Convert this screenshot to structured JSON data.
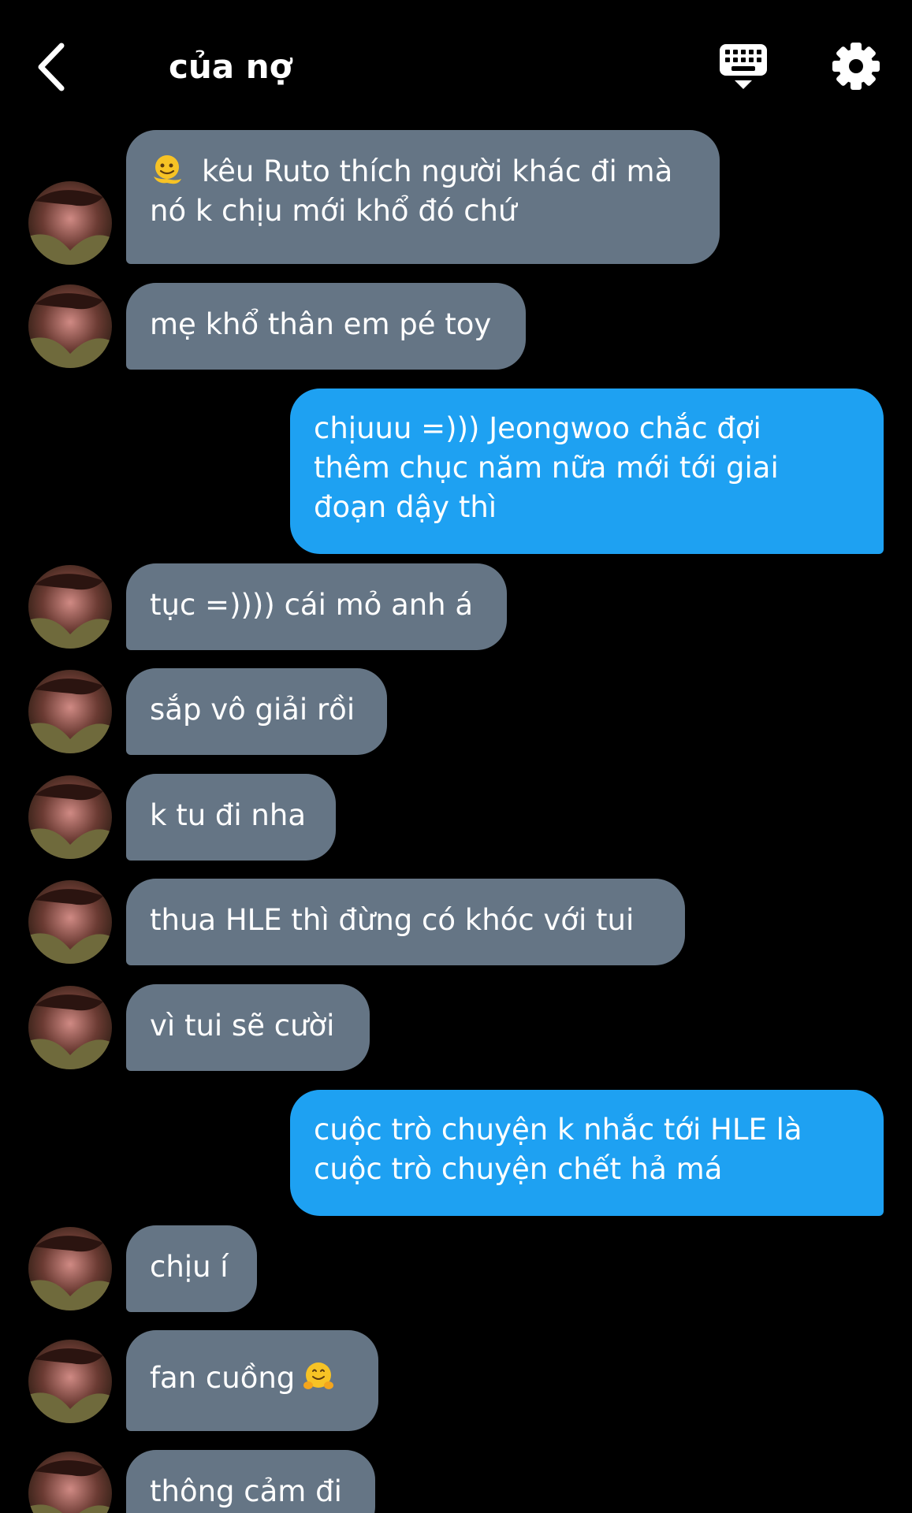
{
  "header": {
    "title": "của nợ",
    "back_icon": "chevron-left-icon",
    "keyboard_icon": "keyboard-icon",
    "settings_icon": "gear-icon"
  },
  "colors": {
    "background": "#000000",
    "incoming_bubble": "#657585",
    "outgoing_bubble": "#1ea1f2",
    "text": "#ffffff"
  },
  "messages": [
    {
      "side": "incoming",
      "emoji": "melting-face-emoji",
      "text": "kêu Ruto thích người khác đi mà\nnó k chịu mới khổ đó chứ"
    },
    {
      "side": "incoming",
      "text": "mẹ khổ thân em pé toy"
    },
    {
      "side": "outgoing",
      "text": "chịuuu =))) Jeongwoo chắc đợi\nthêm chục năm nữa mới tới giai\nđoạn dậy thì"
    },
    {
      "side": "incoming",
      "text": "tục =)))) cái mỏ anh á"
    },
    {
      "side": "incoming",
      "text": "sắp vô giải rồi"
    },
    {
      "side": "incoming",
      "text": "k tu đi nha"
    },
    {
      "side": "incoming",
      "text": "thua HLE thì đừng có khóc với tui"
    },
    {
      "side": "incoming",
      "text": "vì tui sẽ cười"
    },
    {
      "side": "outgoing",
      "text": "cuộc trò chuyện k nhắc tới HLE là\ncuộc trò chuyện chết hả má"
    },
    {
      "side": "incoming",
      "text": "chịu í"
    },
    {
      "side": "incoming",
      "text": "fan cuồng",
      "emoji_after": "hugging-face-emoji"
    },
    {
      "side": "incoming",
      "text": "thông cảm đi"
    }
  ]
}
